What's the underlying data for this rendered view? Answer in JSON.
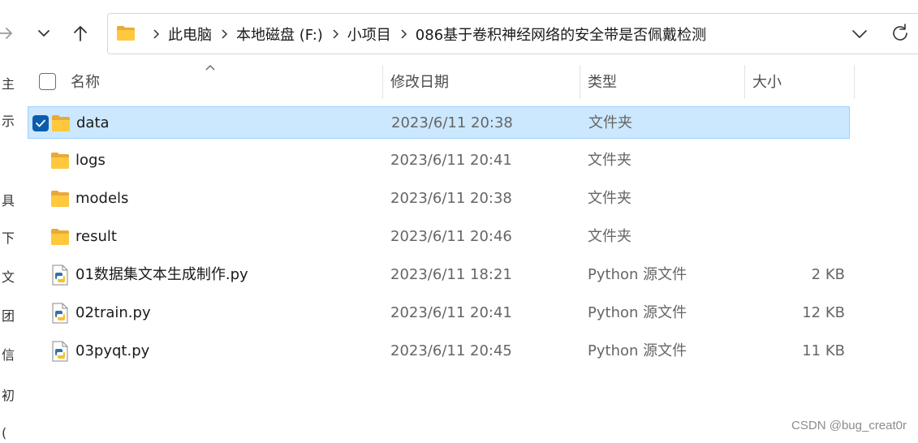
{
  "address_bar": {
    "breadcrumbs": [
      "此电脑",
      "本地磁盘 (F:)",
      "小项目",
      "086基于卷积神经网络的安全带是否佩戴检测"
    ],
    "folder_icon": "folder-icon"
  },
  "columns": {
    "name": "名称",
    "date": "修改日期",
    "type": "类型",
    "size": "大小"
  },
  "files": [
    {
      "name": "data",
      "date": "2023/6/11 20:38",
      "type": "文件夹",
      "size": "",
      "icon": "folder-icon",
      "selected": true
    },
    {
      "name": "logs",
      "date": "2023/6/11 20:41",
      "type": "文件夹",
      "size": "",
      "icon": "folder-icon",
      "selected": false
    },
    {
      "name": "models",
      "date": "2023/6/11 20:38",
      "type": "文件夹",
      "size": "",
      "icon": "folder-icon",
      "selected": false
    },
    {
      "name": "result",
      "date": "2023/6/11 20:46",
      "type": "文件夹",
      "size": "",
      "icon": "folder-icon",
      "selected": false
    },
    {
      "name": "01数据集文本生成制作.py",
      "date": "2023/6/11 18:21",
      "type": "Python 源文件",
      "size": "2 KB",
      "icon": "python-file-icon",
      "selected": false
    },
    {
      "name": "02train.py",
      "date": "2023/6/11 20:41",
      "type": "Python 源文件",
      "size": "12 KB",
      "icon": "python-file-icon",
      "selected": false
    },
    {
      "name": "03pyqt.py",
      "date": "2023/6/11 20:45",
      "type": "Python 源文件",
      "size": "11 KB",
      "icon": "python-file-icon",
      "selected": false
    }
  ],
  "left_pane_glyphs": [
    "主",
    "示",
    "具",
    "下",
    "文",
    "团",
    "信",
    "初",
    "("
  ],
  "watermark": "CSDN @bug_creat0r",
  "colors": {
    "selection_bg": "#cce8ff",
    "selection_border": "#99d1ff",
    "checkbox_checked": "#0b5cad",
    "folder_yellow": "#ffc83d",
    "secondary_text": "#666666"
  }
}
